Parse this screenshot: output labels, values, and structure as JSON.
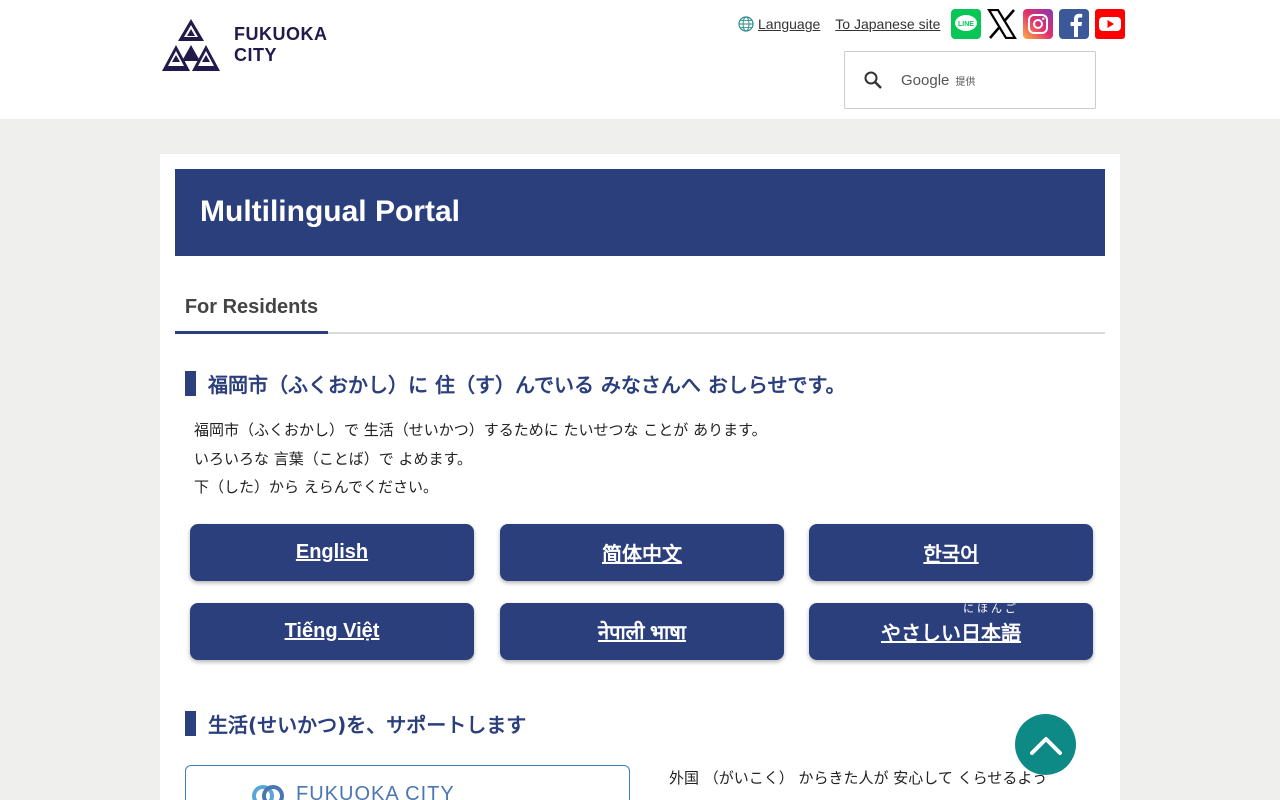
{
  "header": {
    "logo_line1": "FUKUOKA",
    "logo_line2": "CITY",
    "language_label": "Language",
    "japanese_site_label": "To Japanese site",
    "sns": [
      {
        "name": "line-icon",
        "label": "LINE",
        "color": "#06c755"
      },
      {
        "name": "x-icon",
        "label": "X",
        "color": "#000000"
      },
      {
        "name": "instagram-icon",
        "label": "Instagram",
        "color": "#d62976"
      },
      {
        "name": "facebook-icon",
        "label": "Facebook",
        "color": "#3b5998"
      },
      {
        "name": "youtube-icon",
        "label": "YouTube",
        "color": "#ff0000"
      }
    ],
    "search": {
      "brand": "Google",
      "sub": "提供"
    }
  },
  "main": {
    "title": "Multilingual Portal",
    "tab": "For Residents",
    "section1_heading": "福岡市（ふくおかし）に 住（す）んでいる みなさんへ おしらせです。",
    "intro_lines": [
      "福岡市（ふくおかし）で 生活（せいかつ）するために たいせつな ことが あります。",
      "いろいろな 言葉（ことば）で よめます。",
      "下（した）から えらんでください。"
    ],
    "languages": [
      {
        "label": "English"
      },
      {
        "label": "简体中文"
      },
      {
        "label": "한국어"
      },
      {
        "label": "Tiếng Việt"
      },
      {
        "label": "नेपाली भाषा"
      },
      {
        "label": "やさしい日本語",
        "ruby": "にほんご"
      }
    ],
    "section2_heading": "生活(せいかつ)を、サポートします",
    "promo_logo_text": "FUKUOKA CITY",
    "side_text": "外国 （がいこく） からきた人が 安心して くらせるよう"
  },
  "colors": {
    "primary": "#2b3f7d",
    "background": "#efefed",
    "totop": "#0e8a86"
  }
}
